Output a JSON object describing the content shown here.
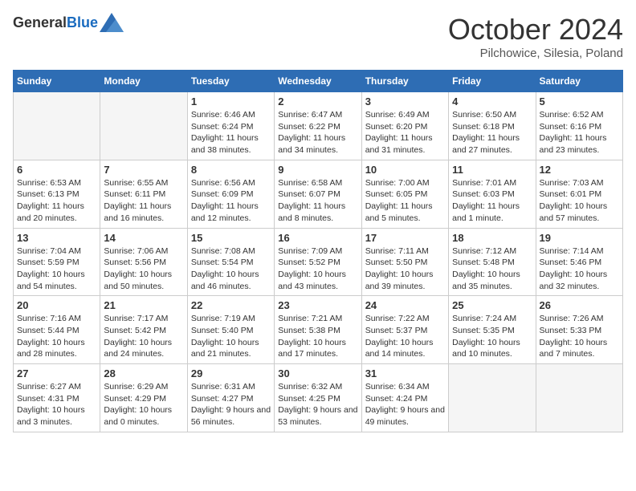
{
  "header": {
    "logo_general": "General",
    "logo_blue": "Blue",
    "month_title": "October 2024",
    "subtitle": "Pilchowice, Silesia, Poland"
  },
  "days_of_week": [
    "Sunday",
    "Monday",
    "Tuesday",
    "Wednesday",
    "Thursday",
    "Friday",
    "Saturday"
  ],
  "weeks": [
    [
      {
        "day": "",
        "sunrise": "",
        "sunset": "",
        "daylight": "",
        "empty": true
      },
      {
        "day": "",
        "sunrise": "",
        "sunset": "",
        "daylight": "",
        "empty": true
      },
      {
        "day": "1",
        "sunrise": "Sunrise: 6:46 AM",
        "sunset": "Sunset: 6:24 PM",
        "daylight": "Daylight: 11 hours and 38 minutes."
      },
      {
        "day": "2",
        "sunrise": "Sunrise: 6:47 AM",
        "sunset": "Sunset: 6:22 PM",
        "daylight": "Daylight: 11 hours and 34 minutes."
      },
      {
        "day": "3",
        "sunrise": "Sunrise: 6:49 AM",
        "sunset": "Sunset: 6:20 PM",
        "daylight": "Daylight: 11 hours and 31 minutes."
      },
      {
        "day": "4",
        "sunrise": "Sunrise: 6:50 AM",
        "sunset": "Sunset: 6:18 PM",
        "daylight": "Daylight: 11 hours and 27 minutes."
      },
      {
        "day": "5",
        "sunrise": "Sunrise: 6:52 AM",
        "sunset": "Sunset: 6:16 PM",
        "daylight": "Daylight: 11 hours and 23 minutes."
      }
    ],
    [
      {
        "day": "6",
        "sunrise": "Sunrise: 6:53 AM",
        "sunset": "Sunset: 6:13 PM",
        "daylight": "Daylight: 11 hours and 20 minutes."
      },
      {
        "day": "7",
        "sunrise": "Sunrise: 6:55 AM",
        "sunset": "Sunset: 6:11 PM",
        "daylight": "Daylight: 11 hours and 16 minutes."
      },
      {
        "day": "8",
        "sunrise": "Sunrise: 6:56 AM",
        "sunset": "Sunset: 6:09 PM",
        "daylight": "Daylight: 11 hours and 12 minutes."
      },
      {
        "day": "9",
        "sunrise": "Sunrise: 6:58 AM",
        "sunset": "Sunset: 6:07 PM",
        "daylight": "Daylight: 11 hours and 8 minutes."
      },
      {
        "day": "10",
        "sunrise": "Sunrise: 7:00 AM",
        "sunset": "Sunset: 6:05 PM",
        "daylight": "Daylight: 11 hours and 5 minutes."
      },
      {
        "day": "11",
        "sunrise": "Sunrise: 7:01 AM",
        "sunset": "Sunset: 6:03 PM",
        "daylight": "Daylight: 11 hours and 1 minute."
      },
      {
        "day": "12",
        "sunrise": "Sunrise: 7:03 AM",
        "sunset": "Sunset: 6:01 PM",
        "daylight": "Daylight: 10 hours and 57 minutes."
      }
    ],
    [
      {
        "day": "13",
        "sunrise": "Sunrise: 7:04 AM",
        "sunset": "Sunset: 5:59 PM",
        "daylight": "Daylight: 10 hours and 54 minutes."
      },
      {
        "day": "14",
        "sunrise": "Sunrise: 7:06 AM",
        "sunset": "Sunset: 5:56 PM",
        "daylight": "Daylight: 10 hours and 50 minutes."
      },
      {
        "day": "15",
        "sunrise": "Sunrise: 7:08 AM",
        "sunset": "Sunset: 5:54 PM",
        "daylight": "Daylight: 10 hours and 46 minutes."
      },
      {
        "day": "16",
        "sunrise": "Sunrise: 7:09 AM",
        "sunset": "Sunset: 5:52 PM",
        "daylight": "Daylight: 10 hours and 43 minutes."
      },
      {
        "day": "17",
        "sunrise": "Sunrise: 7:11 AM",
        "sunset": "Sunset: 5:50 PM",
        "daylight": "Daylight: 10 hours and 39 minutes."
      },
      {
        "day": "18",
        "sunrise": "Sunrise: 7:12 AM",
        "sunset": "Sunset: 5:48 PM",
        "daylight": "Daylight: 10 hours and 35 minutes."
      },
      {
        "day": "19",
        "sunrise": "Sunrise: 7:14 AM",
        "sunset": "Sunset: 5:46 PM",
        "daylight": "Daylight: 10 hours and 32 minutes."
      }
    ],
    [
      {
        "day": "20",
        "sunrise": "Sunrise: 7:16 AM",
        "sunset": "Sunset: 5:44 PM",
        "daylight": "Daylight: 10 hours and 28 minutes."
      },
      {
        "day": "21",
        "sunrise": "Sunrise: 7:17 AM",
        "sunset": "Sunset: 5:42 PM",
        "daylight": "Daylight: 10 hours and 24 minutes."
      },
      {
        "day": "22",
        "sunrise": "Sunrise: 7:19 AM",
        "sunset": "Sunset: 5:40 PM",
        "daylight": "Daylight: 10 hours and 21 minutes."
      },
      {
        "day": "23",
        "sunrise": "Sunrise: 7:21 AM",
        "sunset": "Sunset: 5:38 PM",
        "daylight": "Daylight: 10 hours and 17 minutes."
      },
      {
        "day": "24",
        "sunrise": "Sunrise: 7:22 AM",
        "sunset": "Sunset: 5:37 PM",
        "daylight": "Daylight: 10 hours and 14 minutes."
      },
      {
        "day": "25",
        "sunrise": "Sunrise: 7:24 AM",
        "sunset": "Sunset: 5:35 PM",
        "daylight": "Daylight: 10 hours and 10 minutes."
      },
      {
        "day": "26",
        "sunrise": "Sunrise: 7:26 AM",
        "sunset": "Sunset: 5:33 PM",
        "daylight": "Daylight: 10 hours and 7 minutes."
      }
    ],
    [
      {
        "day": "27",
        "sunrise": "Sunrise: 6:27 AM",
        "sunset": "Sunset: 4:31 PM",
        "daylight": "Daylight: 10 hours and 3 minutes."
      },
      {
        "day": "28",
        "sunrise": "Sunrise: 6:29 AM",
        "sunset": "Sunset: 4:29 PM",
        "daylight": "Daylight: 10 hours and 0 minutes."
      },
      {
        "day": "29",
        "sunrise": "Sunrise: 6:31 AM",
        "sunset": "Sunset: 4:27 PM",
        "daylight": "Daylight: 9 hours and 56 minutes."
      },
      {
        "day": "30",
        "sunrise": "Sunrise: 6:32 AM",
        "sunset": "Sunset: 4:25 PM",
        "daylight": "Daylight: 9 hours and 53 minutes."
      },
      {
        "day": "31",
        "sunrise": "Sunrise: 6:34 AM",
        "sunset": "Sunset: 4:24 PM",
        "daylight": "Daylight: 9 hours and 49 minutes."
      },
      {
        "day": "",
        "sunrise": "",
        "sunset": "",
        "daylight": "",
        "empty": true
      },
      {
        "day": "",
        "sunrise": "",
        "sunset": "",
        "daylight": "",
        "empty": true
      }
    ]
  ]
}
